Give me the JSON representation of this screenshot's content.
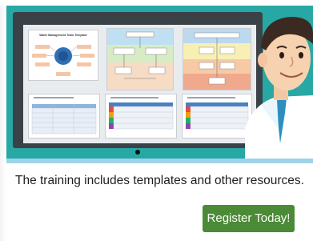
{
  "thumbnails": {
    "main_title": "Water Management Team Template"
  },
  "caption": "The training includes templates and other resources.",
  "cta": {
    "label": "Register Today!",
    "color": "#4b8a36"
  },
  "colors": {
    "hero_background": "#27a8a4",
    "monitor": "#3b4247",
    "strip": "#9fd3ea"
  },
  "illustration": {
    "character": "cartoon-presenter-man-icon"
  }
}
